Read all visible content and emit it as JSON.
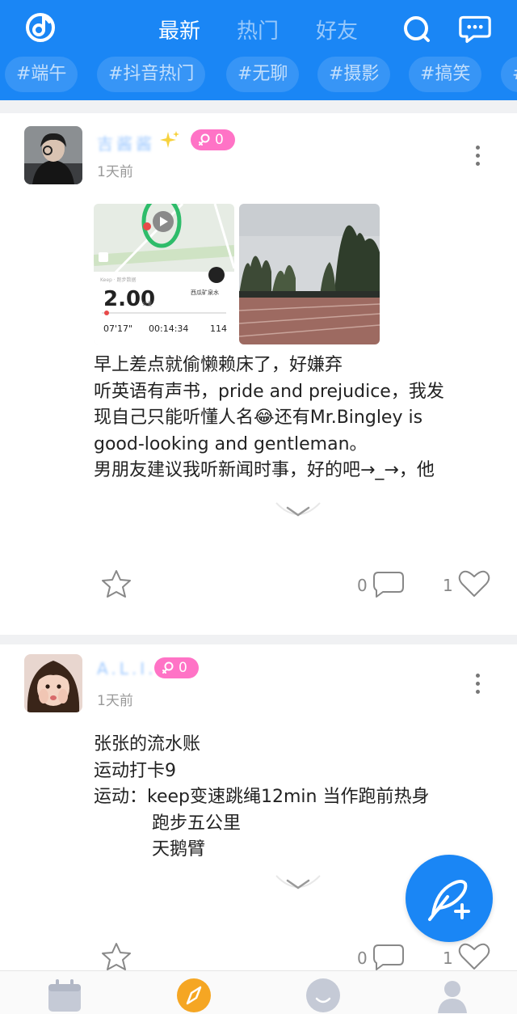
{
  "header": {
    "tabs": [
      {
        "label": "最新",
        "active": true
      },
      {
        "label": "热门",
        "active": false
      },
      {
        "label": "好友",
        "active": false
      }
    ],
    "hashtags": [
      "#端午",
      "#抖音热门",
      "#无聊",
      "#摄影",
      "#搞笑",
      "#"
    ]
  },
  "posts": [
    {
      "username": "吉酱酱",
      "level": "0",
      "time": "1天前",
      "tracker": {
        "distance": "2.00",
        "pace": "07'17\"",
        "duration": "00:14:34",
        "calories": "114",
        "location": "西瓜矿泉水"
      },
      "lines": [
        "早上差点就偷懒赖床了，好嫌弃",
        "听英语有声书，pride and prejudice，我发",
        "现自己只能听懂人名😂还有Mr.Bingley is",
        "good-looking and gentleman。",
        "男朋友建议我听新闻时事，好的吧→_→，他"
      ],
      "comments": "0",
      "likes": "1"
    },
    {
      "username": "A.L.I.M",
      "level": "0",
      "time": "1天前",
      "lines": [
        "张张的流水账",
        "运动打卡9",
        "运动：keep变速跳绳12min  当作跑前热身"
      ],
      "indented_lines": [
        "跑步五公里",
        "天鹅臂"
      ],
      "comments": "0",
      "likes": "1"
    }
  ],
  "colors": {
    "brand": "#1a86f5",
    "level_badge": "#ff73c6",
    "discover_active": "#f5a623"
  }
}
